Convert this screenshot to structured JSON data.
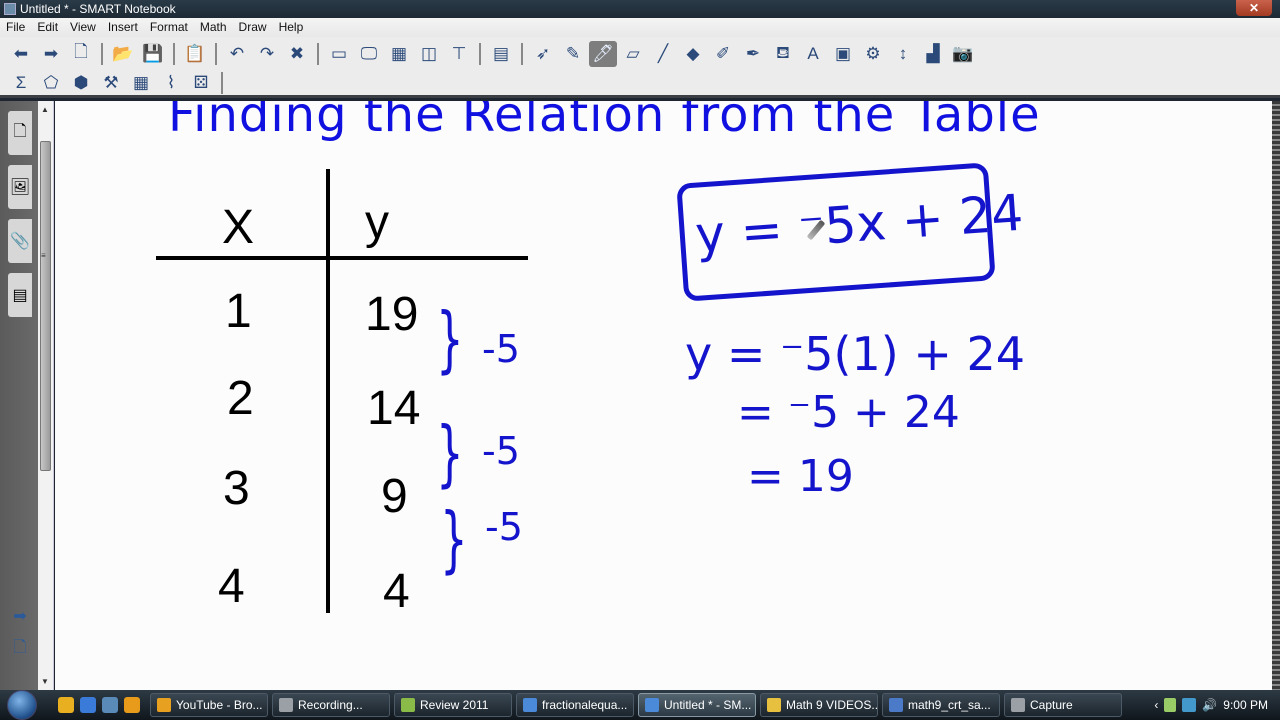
{
  "window": {
    "title": "Untitled * - SMART Notebook",
    "close_label": "✕"
  },
  "menu": [
    "File",
    "Edit",
    "View",
    "Insert",
    "Format",
    "Math",
    "Draw",
    "Help"
  ],
  "toolbar_main": [
    {
      "name": "back-icon",
      "glyph": "⬅"
    },
    {
      "name": "forward-icon",
      "glyph": "➡"
    },
    {
      "name": "add-page-icon",
      "glyph": "🗋"
    },
    {
      "sep": true
    },
    {
      "name": "open-file-icon",
      "glyph": "📂"
    },
    {
      "name": "save-icon",
      "glyph": "💾"
    },
    {
      "sep": true
    },
    {
      "name": "paste-icon",
      "glyph": "📋"
    },
    {
      "sep": true
    },
    {
      "name": "undo-icon",
      "glyph": "↶"
    },
    {
      "name": "redo-icon",
      "glyph": "↷"
    },
    {
      "name": "delete-icon",
      "glyph": "✖"
    },
    {
      "sep": true
    },
    {
      "name": "screen-shade-icon",
      "glyph": "▭"
    },
    {
      "name": "full-screen-icon",
      "glyph": "🖵"
    },
    {
      "name": "transparent-background-icon",
      "glyph": "▦"
    },
    {
      "name": "dual-page-icon",
      "glyph": "◫"
    },
    {
      "name": "document-camera-icon",
      "glyph": "⊤"
    },
    {
      "sep": true
    },
    {
      "name": "table-icon",
      "glyph": "▤"
    },
    {
      "sep": true
    },
    {
      "name": "select-icon",
      "glyph": "➶"
    },
    {
      "name": "pen-icon",
      "glyph": "✎"
    },
    {
      "name": "creative-pen-icon",
      "glyph": "🖊",
      "active": true
    },
    {
      "name": "eraser-icon",
      "glyph": "▱"
    },
    {
      "name": "line-icon",
      "glyph": "╱"
    },
    {
      "name": "shapes-icon",
      "glyph": "◆"
    },
    {
      "name": "regular-polygon-icon",
      "glyph": "✐"
    },
    {
      "name": "magic-pen-icon",
      "glyph": "✒"
    },
    {
      "name": "fill-icon",
      "glyph": "⛾"
    },
    {
      "name": "text-icon",
      "glyph": "A"
    },
    {
      "name": "properties-icon",
      "glyph": "▣"
    },
    {
      "name": "measurement-tools-icon",
      "glyph": "⚙"
    },
    {
      "name": "move-toolbar-icon",
      "glyph": "↕"
    },
    {
      "name": "recorder-icon",
      "glyph": "▟"
    },
    {
      "name": "screen-capture-icon",
      "glyph": "📷"
    }
  ],
  "toolbar_math": [
    {
      "name": "sigma-icon",
      "glyph": "Σ"
    },
    {
      "name": "polygon-icon",
      "glyph": "⬠"
    },
    {
      "name": "3d-shapes-icon",
      "glyph": "⬢"
    },
    {
      "name": "geometry-tools-icon",
      "glyph": "⚒"
    },
    {
      "name": "table-sigma-icon",
      "glyph": "▦"
    },
    {
      "name": "graph-icon",
      "glyph": "⌇"
    },
    {
      "name": "math-tools-icon",
      "glyph": "⚄"
    },
    {
      "sep": true
    }
  ],
  "side_tabs": [
    {
      "name": "page-sorter-tab",
      "glyph": "🗋"
    },
    {
      "name": "gallery-tab",
      "glyph": "🖼"
    },
    {
      "name": "attachments-tab",
      "glyph": "📎"
    },
    {
      "name": "properties-tab",
      "glyph": "▤"
    }
  ],
  "side_bottom": [
    {
      "name": "forward-arrow-icon",
      "glyph": "➡"
    },
    {
      "name": "add-page-icon",
      "glyph": "🗋"
    }
  ],
  "page": {
    "title": "Finding the Relation from the Table",
    "table": {
      "headers": [
        "X",
        "y"
      ],
      "rows": [
        {
          "x": "1",
          "y": "19"
        },
        {
          "x": "2",
          "y": "14"
        },
        {
          "x": "3",
          "y": "9"
        },
        {
          "x": "4",
          "y": "4"
        }
      ],
      "differences": [
        "-5",
        "-5",
        "-5"
      ]
    },
    "equation": "y = ⁻5x + 24",
    "work": [
      "y = ⁻5(1) + 24",
      "= ⁻5 + 24",
      "= 19"
    ]
  },
  "taskbar": {
    "quick_launch": [
      {
        "name": "chrome-icon",
        "color": "#e8b020"
      },
      {
        "name": "internet-explorer-icon",
        "color": "#3a7ad8"
      },
      {
        "name": "show-desktop-icon",
        "color": "#5a8ab8"
      },
      {
        "name": "media-player-icon",
        "color": "#e89a1a"
      }
    ],
    "tasks": [
      {
        "label": "YouTube - Bro...",
        "color": "#e8a020",
        "width": 118
      },
      {
        "label": "Recording...",
        "color": "#9aa0a6",
        "width": 118
      },
      {
        "label": "Review 2011",
        "color": "#8aba48",
        "width": 118
      },
      {
        "label": "fractionalequa...",
        "color": "#4a8ad8",
        "width": 118
      },
      {
        "label": "Untitled * - SM...",
        "color": "#4a8ad8",
        "width": 118,
        "active": true
      },
      {
        "label": "Math 9 VIDEOS...",
        "color": "#e8c040",
        "width": 118
      },
      {
        "label": "math9_crt_sa...",
        "color": "#4a7ac8",
        "width": 118
      },
      {
        "label": "Capture",
        "color": "#9aa0a6",
        "width": 118
      }
    ],
    "tray": {
      "chevron": "‹",
      "icons": [
        "power-icon",
        "network-icon",
        "volume-icon"
      ],
      "time": "9:00 PM"
    }
  }
}
